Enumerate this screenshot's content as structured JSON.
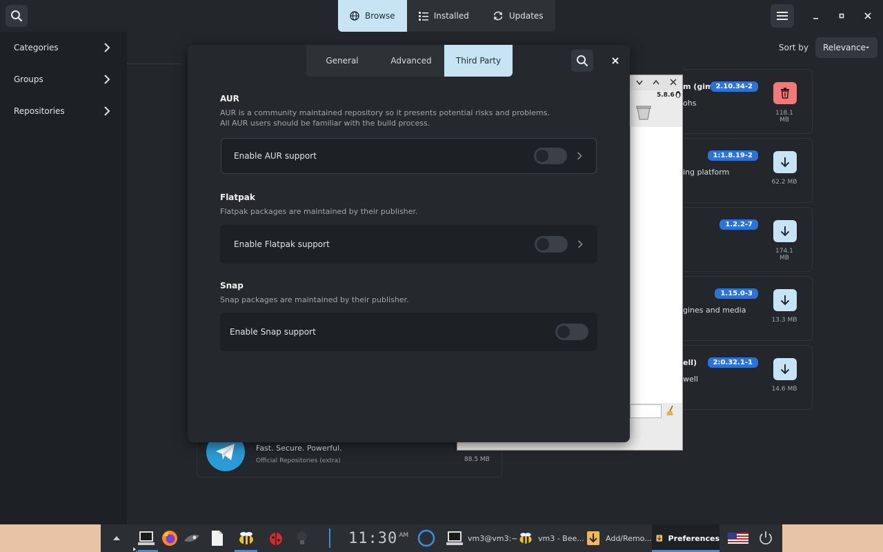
{
  "header": {
    "tabs": [
      {
        "label": "Browse",
        "icon": "globe-icon",
        "active": true
      },
      {
        "label": "Installed",
        "icon": "list-icon",
        "active": false
      },
      {
        "label": "Updates",
        "icon": "refresh-icon",
        "active": false
      }
    ]
  },
  "sidebar": {
    "items": [
      {
        "label": "Categories"
      },
      {
        "label": "Groups"
      },
      {
        "label": "Repositories"
      }
    ]
  },
  "sort": {
    "label": "Sort by",
    "value": "Relevance"
  },
  "packages": [
    {
      "name": "m (gimp)",
      "desc": "ohs",
      "version": "2.10.34-2",
      "size": "118.1 MB",
      "action": "remove"
    },
    {
      "name": "",
      "desc": "ing platform",
      "version": "1:1.8.19-2",
      "size": "62.2 MB",
      "action": "install"
    },
    {
      "name": "",
      "desc": "",
      "version": "1.2.2-7",
      "size": "174.1 MB",
      "action": "install"
    },
    {
      "name": "",
      "desc": "gines and media",
      "version": "1.15.0-3",
      "size": "13.3 MB",
      "action": "install"
    },
    {
      "name": "ell)",
      "desc": "well",
      "version": "2:0.32.1-1",
      "size": "14.6 MB",
      "action": "install"
    }
  ],
  "telegram": {
    "desc": "Fast. Secure. Powerful.",
    "repo": "Official Repositories (extra)",
    "size": "88.5 MB"
  },
  "background_window": {
    "kernel": "5.8.6"
  },
  "dialog": {
    "tabs": [
      {
        "label": "General",
        "active": false
      },
      {
        "label": "Advanced",
        "active": false
      },
      {
        "label": "Third Party",
        "active": true
      }
    ],
    "sections": {
      "aur": {
        "title": "AUR",
        "desc_line1": "AUR is a community maintained repository so it presents potential risks and problems.",
        "desc_line2": "All AUR users should be familiar with the build process.",
        "row_label": "Enable AUR support",
        "enabled": false
      },
      "flatpak": {
        "title": "Flatpak",
        "desc": "Flatpak packages are maintained by their publisher.",
        "row_label": "Enable Flatpak support",
        "enabled": false
      },
      "snap": {
        "title": "Snap",
        "desc": "Snap packages are maintained by their publisher.",
        "row_label": "Enable Snap support",
        "enabled": false
      }
    }
  },
  "taskbar": {
    "clock": "11:30",
    "clock_suffix": "AM",
    "tasks": [
      {
        "label": "vm3@vm3:~"
      },
      {
        "label": "vm3 - Bee..."
      },
      {
        "label": "Add/Remo..."
      },
      {
        "label": "Preferences"
      }
    ]
  },
  "colors": {
    "accent": "#c6e4f4",
    "badge": "#2b73d6",
    "danger": "#f07a7a",
    "taskbar": "#e8c3a6"
  }
}
